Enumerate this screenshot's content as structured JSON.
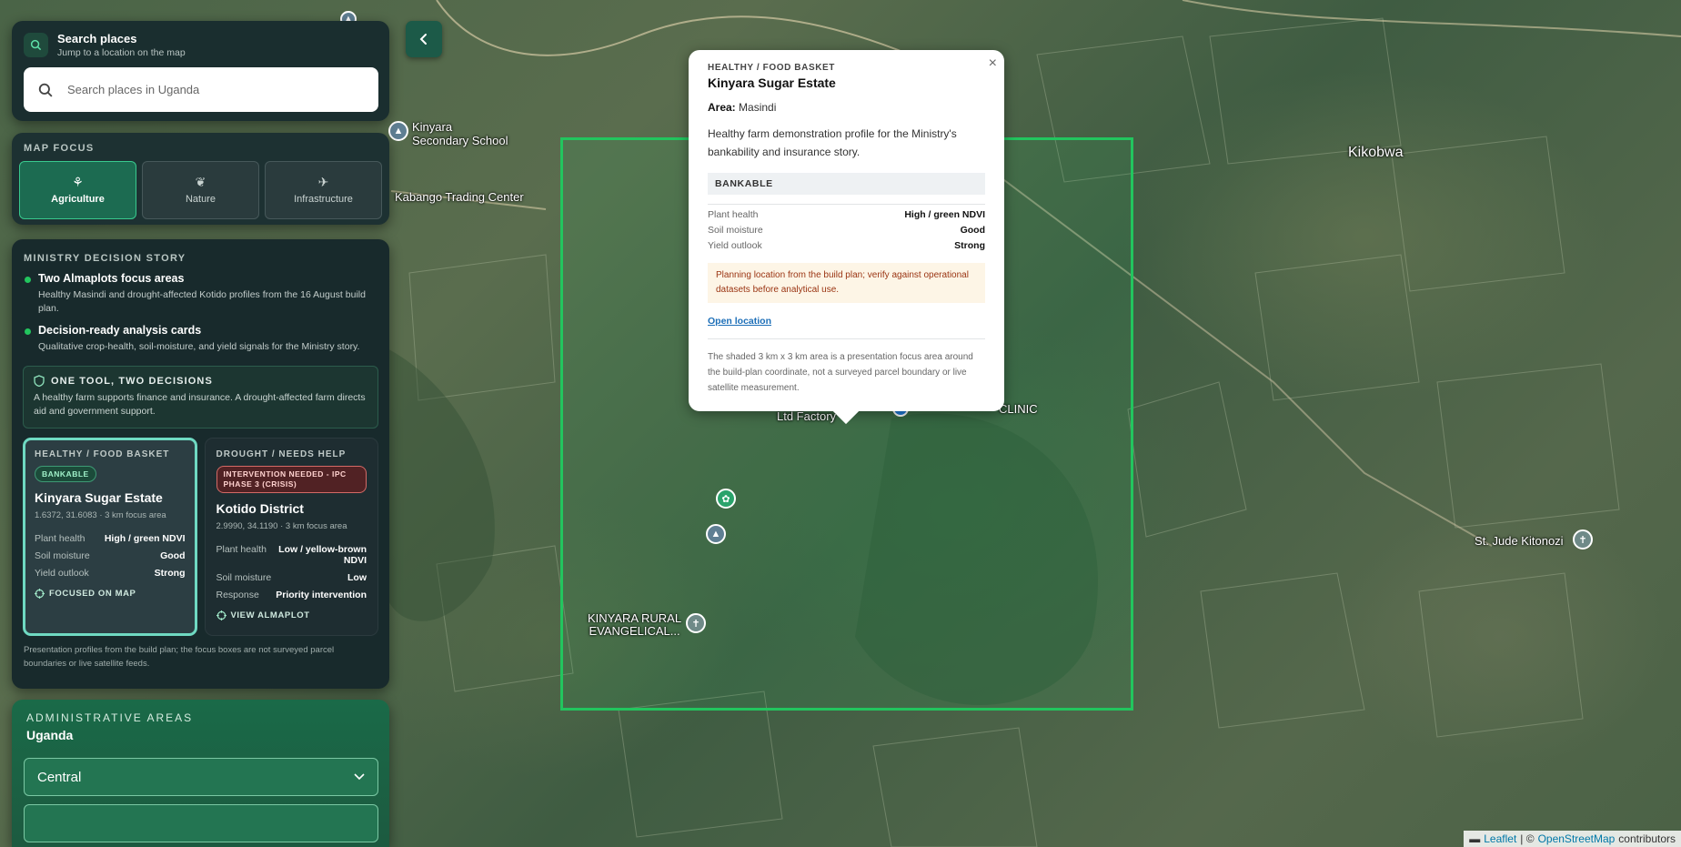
{
  "search": {
    "title": "Search places",
    "subtitle": "Jump to a location on the map",
    "placeholder": "Search places in Uganda"
  },
  "map_focus": {
    "label": "MAP FOCUS",
    "options": [
      {
        "label": "Agriculture",
        "icon": "sprout-icon",
        "active": true
      },
      {
        "label": "Nature",
        "icon": "leaf-icon",
        "active": false
      },
      {
        "label": "Infrastructure",
        "icon": "plane-icon",
        "active": false
      }
    ]
  },
  "story": {
    "label": "MINISTRY DECISION STORY",
    "items": [
      {
        "title": "Two Almaplots focus areas",
        "desc": "Healthy Masindi and drought-affected Kotido profiles from the 16 August build plan."
      },
      {
        "title": "Decision-ready analysis cards",
        "desc": "Qualitative crop-health, soil-moisture, and yield signals for the Ministry story."
      }
    ],
    "tool": {
      "title": "ONE TOOL, TWO DECISIONS",
      "body": "A healthy farm supports finance and insurance. A drought-affected farm directs aid and government support."
    },
    "cards": [
      {
        "category": "HEALTHY / FOOD BASKET",
        "badge": "BANKABLE",
        "name": "Kinyara Sugar Estate",
        "coords": "1.6372, 31.6083 · 3 km focus area",
        "metrics": [
          {
            "k": "Plant health",
            "v": "High / green NDVI"
          },
          {
            "k": "Soil moisture",
            "v": "Good"
          },
          {
            "k": "Yield outlook",
            "v": "Strong"
          }
        ],
        "action": "FOCUSED ON MAP"
      },
      {
        "category": "DROUGHT / NEEDS HELP",
        "badge": "INTERVENTION NEEDED - IPC PHASE 3 (CRISIS)",
        "name": "Kotido District",
        "coords": "2.9990, 34.1190 · 3 km focus area",
        "metrics": [
          {
            "k": "Plant health",
            "v": "Low / yellow-brown NDVI"
          },
          {
            "k": "Soil moisture",
            "v": "Low"
          },
          {
            "k": "Response",
            "v": "Priority intervention"
          }
        ],
        "action": "VIEW ALMAPLOT"
      }
    ],
    "note": "Presentation profiles from the build plan; the focus boxes are not surveyed parcel boundaries or live satellite feeds."
  },
  "admin": {
    "label": "ADMINISTRATIVE AREAS",
    "country": "Uganda",
    "region": "Central"
  },
  "popup": {
    "category": "HEALTHY / FOOD BASKET",
    "name": "Kinyara Sugar Estate",
    "area_label": "Area:",
    "area_value": "Masindi",
    "desc": "Healthy farm demonstration profile for the Ministry's bankability and insurance story.",
    "status": "BANKABLE",
    "metrics": [
      {
        "k": "Plant health",
        "v": "High / green NDVI"
      },
      {
        "k": "Soil moisture",
        "v": "Good"
      },
      {
        "k": "Yield outlook",
        "v": "Strong"
      }
    ],
    "warning": "Planning location from the build plan; verify against operational datasets before analytical use.",
    "link": "Open location",
    "footnote": "The shaded 3 km x 3 km area is a presentation focus area around the build-plan coordinate, not a surveyed parcel boundary or live satellite measurement.",
    "close": "×"
  },
  "map_labels": {
    "school": "Kinyara\nSecondary School",
    "trading": "Kabango Trading Center",
    "kikobwa": "Kikobwa",
    "factory": "Ltd Factory",
    "clinic": "CLINIC",
    "church_label": "KINYARA RURAL\nEVANGELICAL...",
    "st_jude": "St. Jude Kitonozi"
  },
  "attribution": {
    "leaflet": "Leaflet",
    "sep": "| ©",
    "osm": "OpenStreetMap",
    "contrib": "contributors"
  },
  "colors": {
    "accent": "#22c55e",
    "panel": "#17292a",
    "active_focus": "#1c6b51"
  }
}
